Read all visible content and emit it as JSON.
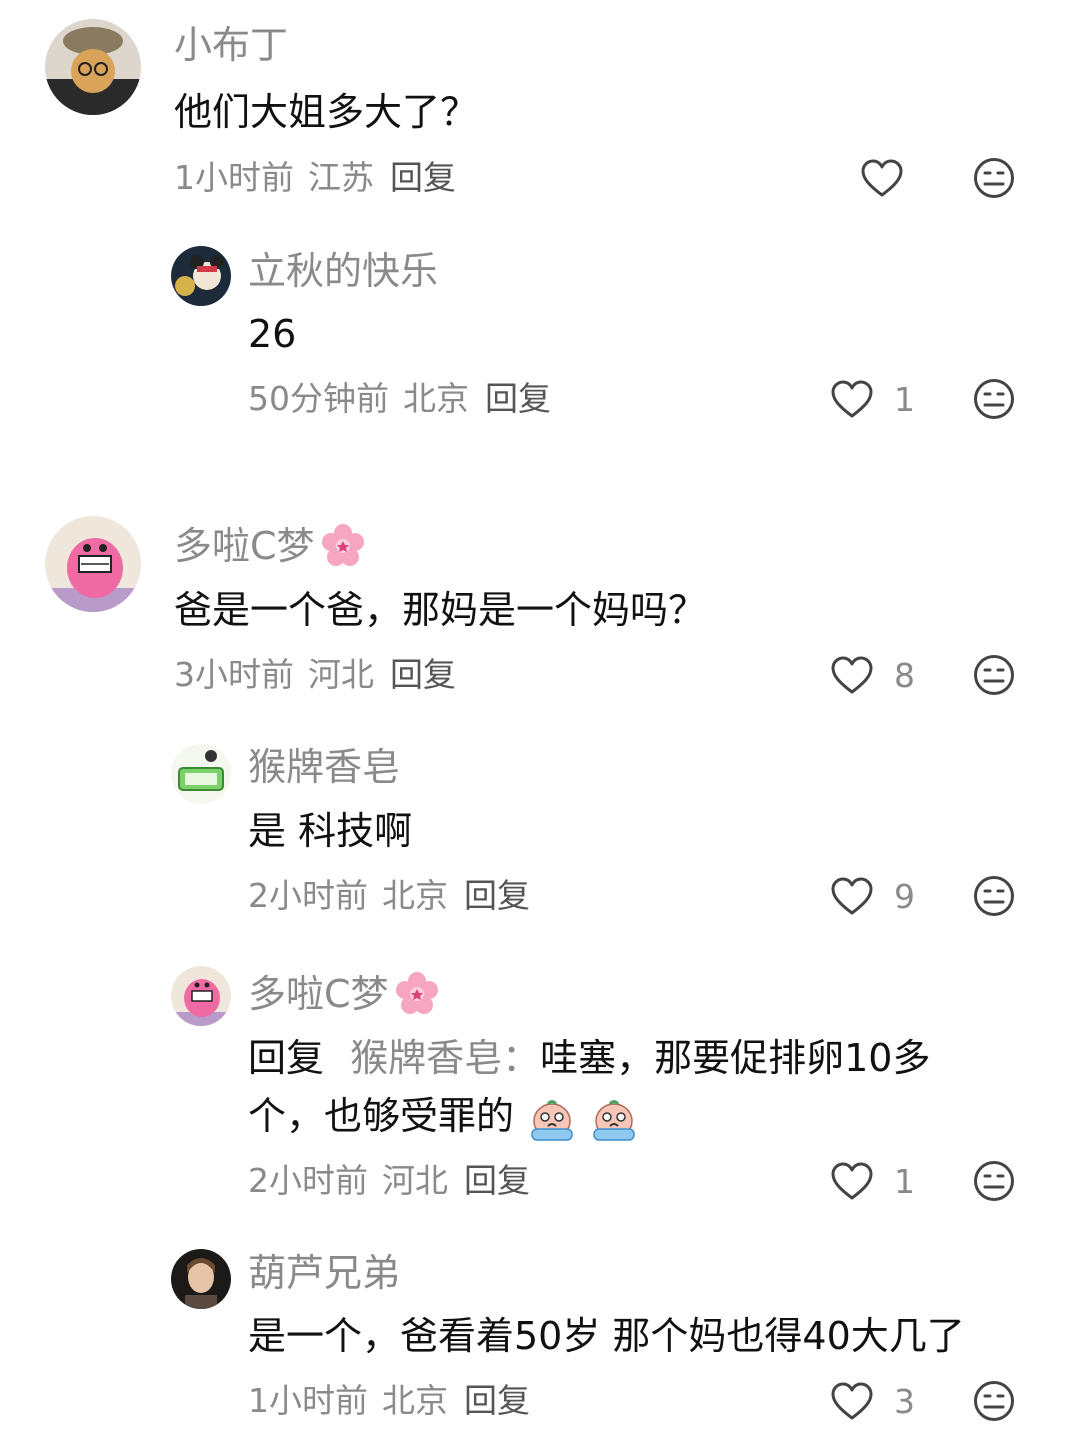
{
  "comments": [
    {
      "name": "小布丁",
      "text": "他们大姐多大了？",
      "time": "1小时前",
      "location": "江苏",
      "reply": "回复",
      "likes": ""
    },
    {
      "name": "立秋的快乐",
      "text": "26",
      "time": "50分钟前",
      "location": "北京",
      "reply": "回复",
      "likes": "1"
    },
    {
      "name": "多啦C梦",
      "text": "爸是一个爸，那妈是一个妈吗？",
      "time": "3小时前",
      "location": "河北",
      "reply": "回复",
      "likes": "8"
    },
    {
      "name": "猴牌香皂",
      "text": "是 科技啊",
      "time": "2小时前",
      "location": "北京",
      "reply": "回复",
      "likes": "9"
    },
    {
      "name": "多啦C梦",
      "reply_prefix": "回复",
      "mention": "猴牌香皂：",
      "text_line1": "哇塞，那要促排卵10多",
      "text_line2": "个，也够受罪的",
      "time": "2小时前",
      "location": "河北",
      "reply": "回复",
      "likes": "1"
    },
    {
      "name": "葫芦兄弟",
      "text": "是一个，爸看着50岁 那个妈也得40大几了",
      "time": "1小时前",
      "location": "北京",
      "reply": "回复",
      "likes": "3"
    }
  ],
  "icons": {
    "like": "heart-outline-icon",
    "dislike": "meh-face-icon",
    "name_badge": "pink-flower-emoji",
    "emoji": "crying-face-emoji"
  },
  "colors": {
    "secondary_text": "#8a8a8a",
    "primary_text": "#111111",
    "icon_stroke": "#444444"
  }
}
